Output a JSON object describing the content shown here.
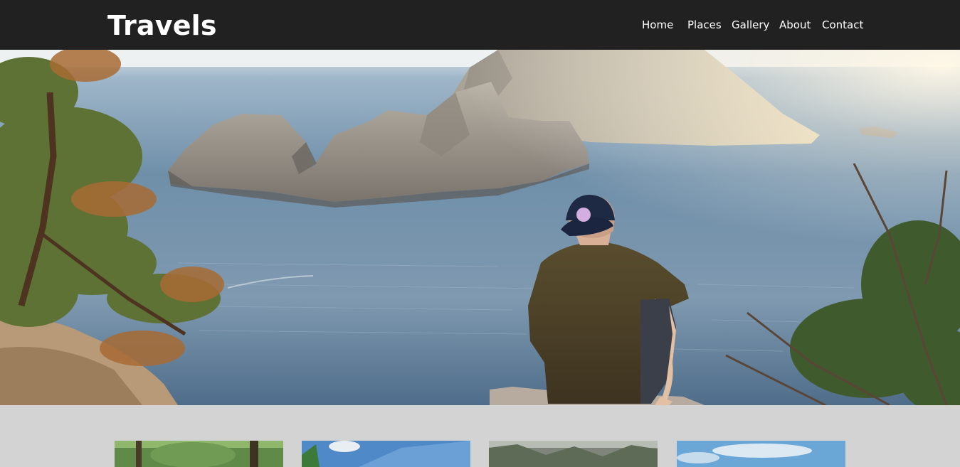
{
  "header": {
    "brand": "Travels",
    "nav": [
      {
        "label": "Home"
      },
      {
        "label": "Places"
      },
      {
        "label": "Gallery"
      },
      {
        "label": "About"
      },
      {
        "label": "Contact"
      }
    ]
  },
  "colors": {
    "navbar_bg": "#212121",
    "page_bg": "#d3d3d3",
    "nav_text": "#ffffff"
  }
}
